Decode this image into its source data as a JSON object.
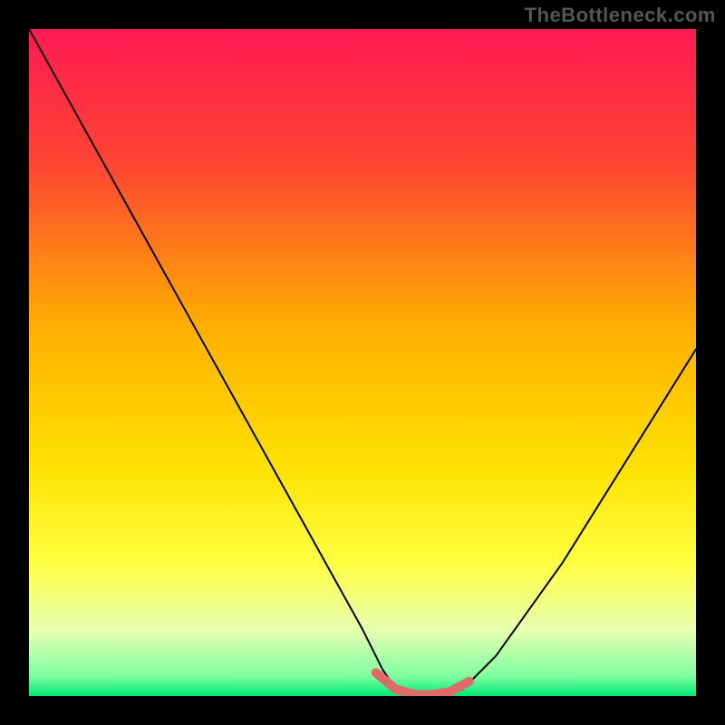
{
  "watermark": "TheBottleneck.com",
  "chart_data": {
    "type": "line",
    "title": "",
    "xlabel": "",
    "ylabel": "",
    "xlim": [
      0,
      100
    ],
    "ylim": [
      0,
      100
    ],
    "legend": false,
    "grid": false,
    "background_gradient": [
      {
        "pos": 0.0,
        "color": "#ff1a53"
      },
      {
        "pos": 0.2,
        "color": "#ff4433"
      },
      {
        "pos": 0.45,
        "color": "#ffb000"
      },
      {
        "pos": 0.65,
        "color": "#ffe000"
      },
      {
        "pos": 0.8,
        "color": "#ffff40"
      },
      {
        "pos": 0.9,
        "color": "#e8ffb0"
      },
      {
        "pos": 0.97,
        "color": "#80ffa0"
      },
      {
        "pos": 1.0,
        "color": "#00e878"
      }
    ],
    "series": [
      {
        "name": "bottleneck-curve",
        "stroke": "#000000",
        "stroke_width": 2,
        "x": [
          0,
          5,
          10,
          15,
          20,
          25,
          30,
          35,
          40,
          45,
          50,
          53,
          55,
          58,
          60,
          62,
          65,
          70,
          75,
          80,
          85,
          90,
          95,
          100
        ],
        "values": [
          100,
          91,
          82,
          73,
          64,
          55,
          46,
          37,
          28,
          19,
          10,
          4,
          1,
          0,
          0,
          0,
          1,
          6,
          13,
          20,
          28,
          36,
          44,
          52
        ]
      },
      {
        "name": "optimal-band-marker",
        "stroke": "#e06a6a",
        "stroke_width": 10,
        "x": [
          52,
          55,
          58,
          60,
          63,
          66
        ],
        "values": [
          3.5,
          1.0,
          0.2,
          0.2,
          0.6,
          2.2
        ]
      }
    ]
  }
}
